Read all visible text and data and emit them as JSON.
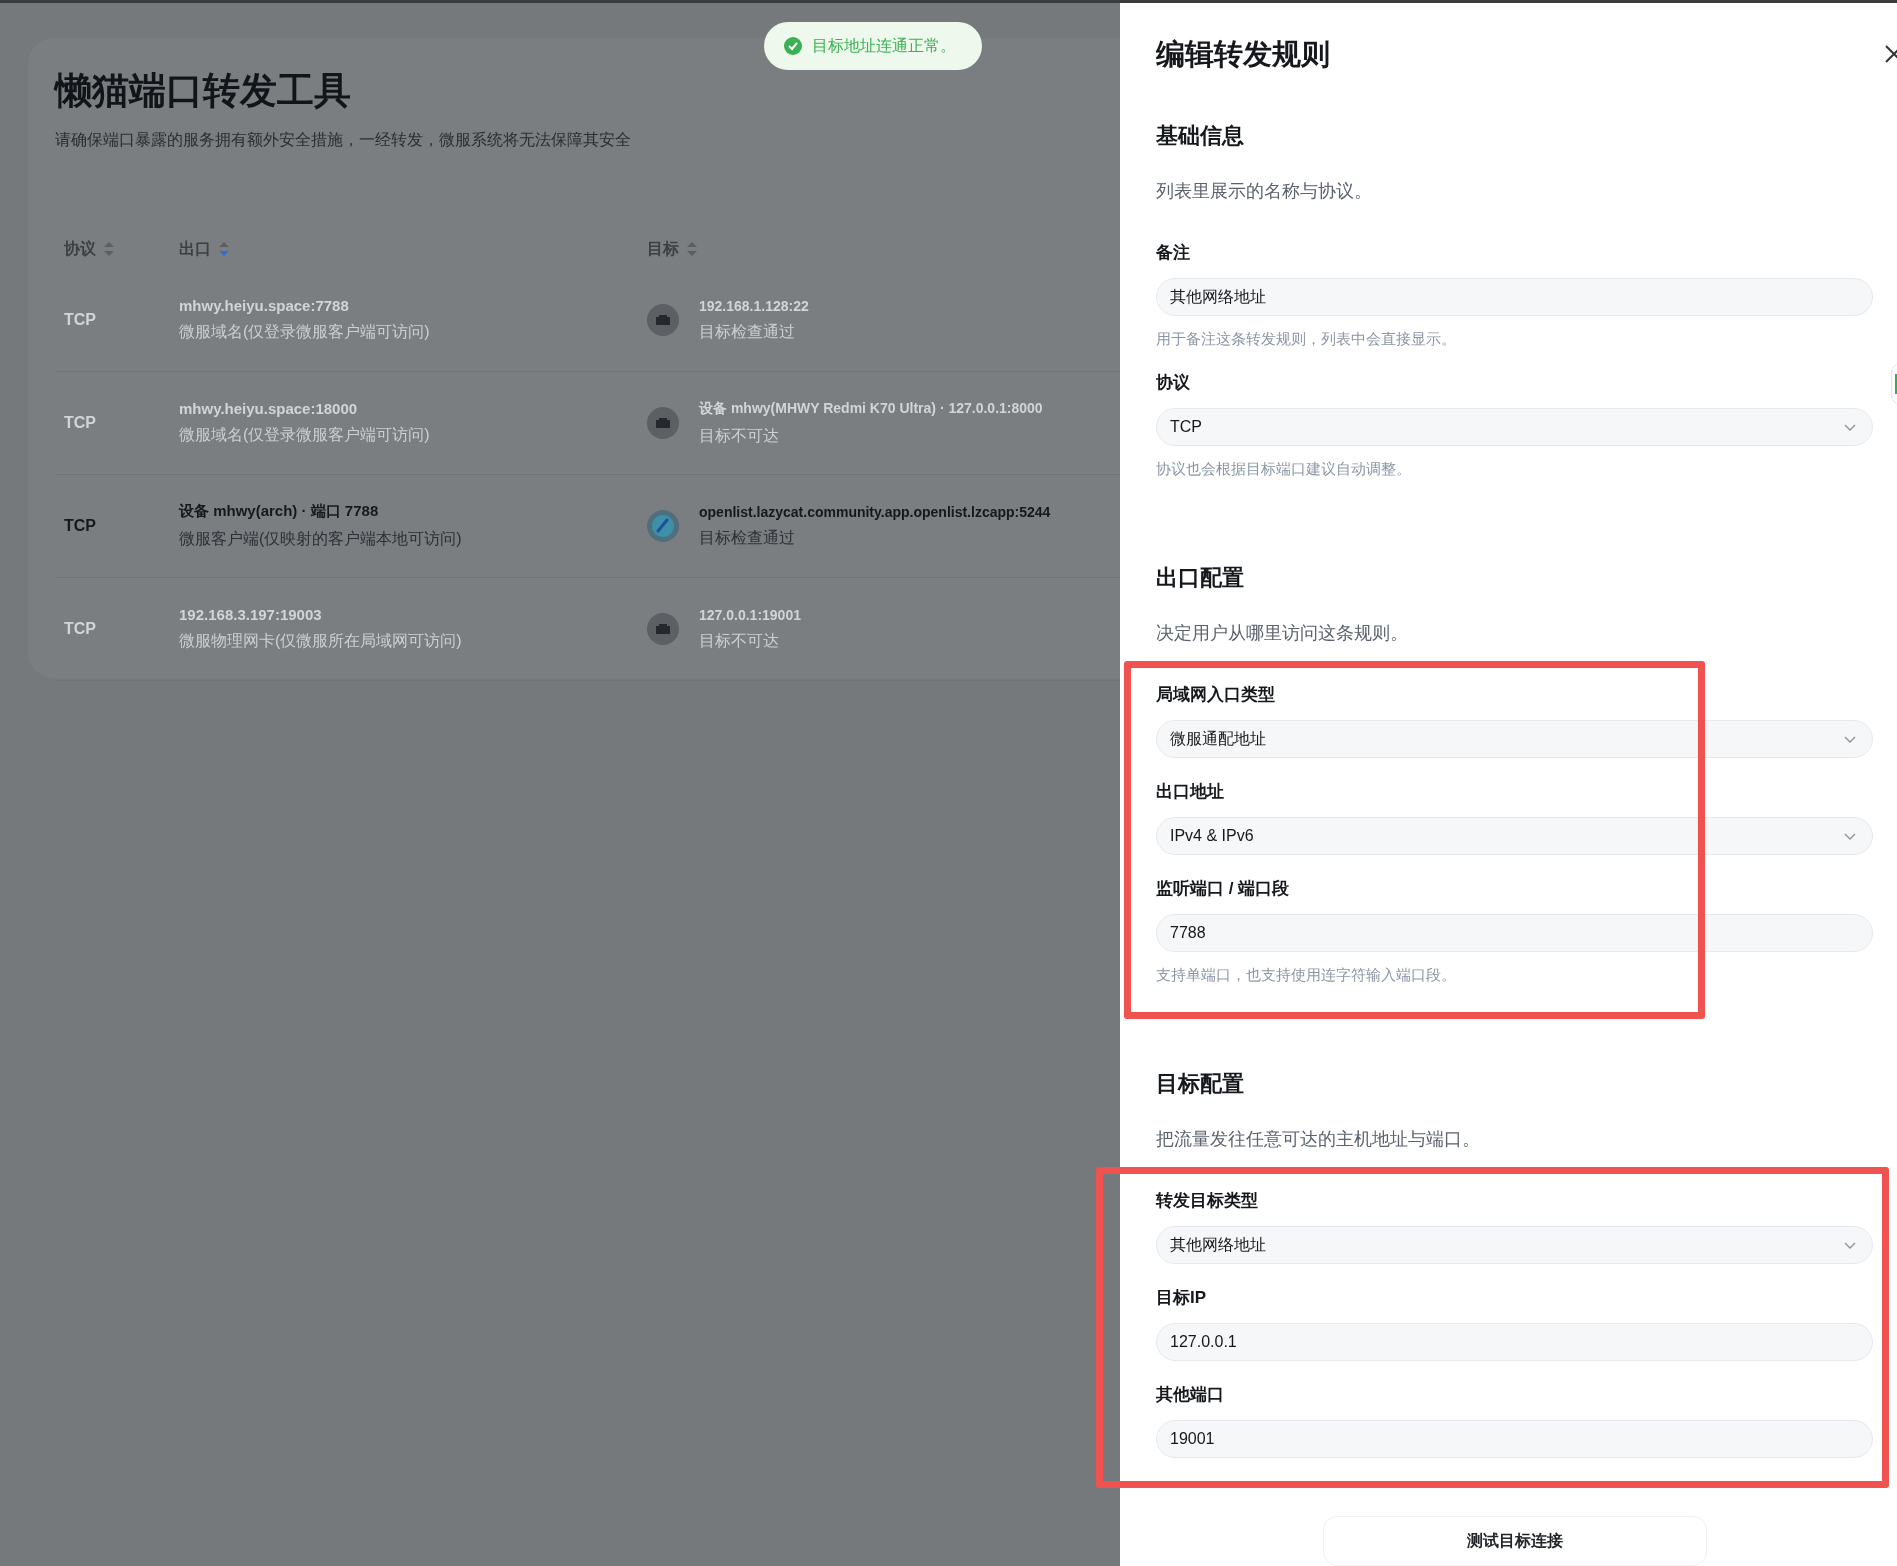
{
  "toast": {
    "kind": "success",
    "text": "目标地址连通正常。"
  },
  "page": {
    "title": "懒猫端口转发工具",
    "subtitle": "请确保端口暴露的服务拥有额外安全措施，一经转发，微服系统将无法保障其安全"
  },
  "table": {
    "columns": [
      {
        "label": "协议",
        "sorted": false
      },
      {
        "label": "出口",
        "sorted": true
      },
      {
        "label": "目标",
        "sorted": false
      }
    ],
    "rows": [
      {
        "selected": false,
        "protocol": "TCP",
        "exit": "mhwy.heiyu.space:7788",
        "exit_note": "微服域名(仅登录微服客户端可访问)",
        "target": {
          "kind": "network",
          "address": "192.168.1.128:22",
          "status": "目标检查通过"
        }
      },
      {
        "selected": false,
        "protocol": "TCP",
        "exit": "mhwy.heiyu.space:18000",
        "exit_note": "微服域名(仅登录微服客户端可访问)",
        "target": {
          "kind": "network",
          "address": "设备 mhwy(MHWY Redmi K70 Ultra) · 127.0.0.1:8000",
          "status": "目标不可达"
        }
      },
      {
        "selected": true,
        "protocol": "TCP",
        "exit": "设备 mhwy(arch) · 端口 7788",
        "exit_note": "微服客户端(仅映射的客户端本地可访问)",
        "target": {
          "kind": "app",
          "address": "openlist.lazycat.community.app.openlist.lzcapp:5244",
          "status": "目标检查通过"
        }
      },
      {
        "selected": false,
        "protocol": "TCP",
        "exit": "192.168.3.197:19003",
        "exit_note": "微服物理网卡(仅微服所在局域网可访问)",
        "target": {
          "kind": "network",
          "address": "127.0.0.1:19001",
          "status": "目标不可达"
        }
      }
    ]
  },
  "drawer": {
    "title": "编辑转发规则",
    "sections": [
      {
        "title": "基础信息",
        "description": "列表里展示的名称与协议。",
        "highlighted": false,
        "fields": [
          {
            "kind": "input",
            "label": "备注",
            "value": "其他网络地址",
            "hint": "用于备注这条转发规则，列表中会直接显示。"
          },
          {
            "kind": "select",
            "label": "协议",
            "value": "TCP",
            "hint": "协议也会根据目标端口建议自动调整。"
          }
        ]
      },
      {
        "title": "出口配置",
        "description": "决定用户从哪里访问这条规则。",
        "highlighted": true,
        "fields": [
          {
            "kind": "select",
            "label": "局域网入口类型",
            "value": "微服通配地址"
          },
          {
            "kind": "select",
            "label": "出口地址",
            "value": "IPv4 & IPv6"
          },
          {
            "kind": "input",
            "label": "监听端口 / 端口段",
            "value": "7788",
            "hint": "支持单端口，也支持使用连字符输入端口段。"
          }
        ]
      },
      {
        "title": "目标配置",
        "description": "把流量发往任意可达的主机地址与端口。",
        "highlighted": true,
        "fields": [
          {
            "kind": "select",
            "label": "转发目标类型",
            "value": "其他网络地址"
          },
          {
            "kind": "input",
            "label": "目标IP",
            "value": "127.0.0.1"
          },
          {
            "kind": "input",
            "label": "其他端口",
            "value": "19001"
          }
        ]
      }
    ],
    "action": "测试目标连接"
  }
}
